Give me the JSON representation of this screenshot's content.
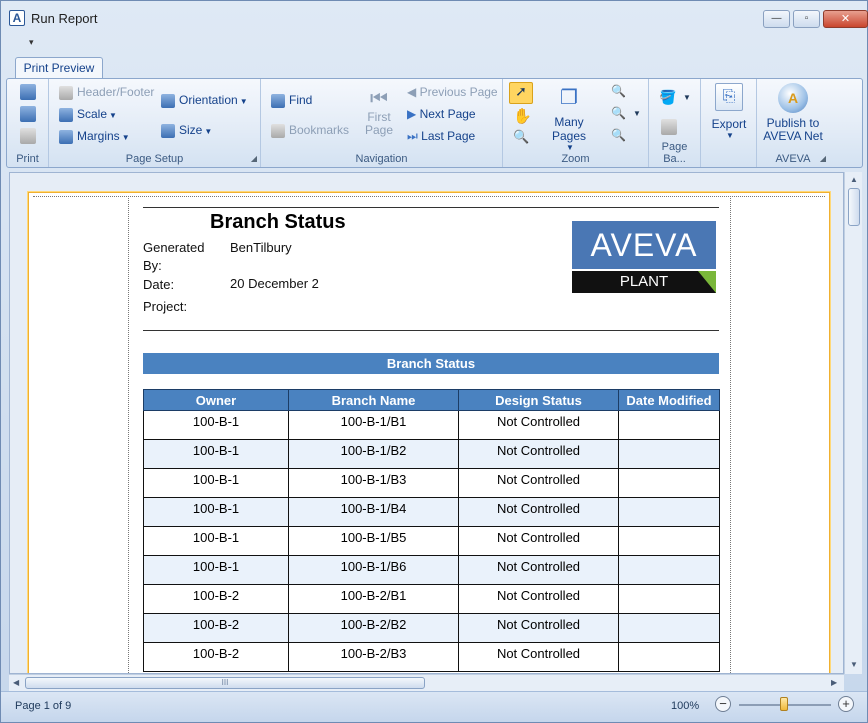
{
  "window": {
    "title": "Run Report",
    "minimize": "—",
    "maximize": "▫",
    "close": "✕",
    "qat": "▾"
  },
  "ribbon": {
    "tab": "Print Preview",
    "groups": {
      "print": {
        "label": "Print"
      },
      "page_setup": {
        "label": "Page Setup",
        "header_footer": "Header/Footer",
        "scale": "Scale",
        "margins": "Margins",
        "orientation": "Orientation",
        "size": "Size"
      },
      "navigation": {
        "label": "Navigation",
        "find": "Find",
        "bookmarks": "Bookmarks",
        "first_page": "First Page",
        "previous_page": "Previous Page",
        "next_page": "Next  Page",
        "last_page": "Last  Page"
      },
      "zoom": {
        "label": "Zoom",
        "many_pages": "Many Pages"
      },
      "page_background": {
        "label": "Page Ba..."
      },
      "export": {
        "label": "Export"
      },
      "aveva": {
        "label": "AVEVA",
        "publish": "Publish to AVEVA Net"
      }
    }
  },
  "report": {
    "title": "Branch Status",
    "generated_by_label": "Generated By:",
    "generated_by": "BenTilbury",
    "date_label": "Date:",
    "date": "20 December 2",
    "project_label": "Project:",
    "logo_top": "AVEVA",
    "logo_bottom": "PLANT",
    "section": "Branch Status",
    "columns": [
      "Owner",
      "Branch  Name",
      "Design Status",
      "Date Modified"
    ],
    "rows": [
      [
        "100-B-1",
        "100-B-1/B1",
        "Not Controlled",
        ""
      ],
      [
        "100-B-1",
        "100-B-1/B2",
        "Not Controlled",
        ""
      ],
      [
        "100-B-1",
        "100-B-1/B3",
        "Not Controlled",
        ""
      ],
      [
        "100-B-1",
        "100-B-1/B4",
        "Not Controlled",
        ""
      ],
      [
        "100-B-1",
        "100-B-1/B5",
        "Not Controlled",
        ""
      ],
      [
        "100-B-1",
        "100-B-1/B6",
        "Not Controlled",
        ""
      ],
      [
        "100-B-2",
        "100-B-2/B1",
        "Not Controlled",
        ""
      ],
      [
        "100-B-2",
        "100-B-2/B2",
        "Not Controlled",
        ""
      ],
      [
        "100-B-2",
        "100-B-2/B3",
        "Not Controlled",
        ""
      ]
    ]
  },
  "status": {
    "page": "Page 1 of 9",
    "zoom": "100%",
    "zoom_out": "−",
    "zoom_in": "+"
  },
  "scroll": {
    "grip": "III",
    "up": "▲",
    "down": "▼",
    "left": "◀",
    "right": "▶"
  }
}
